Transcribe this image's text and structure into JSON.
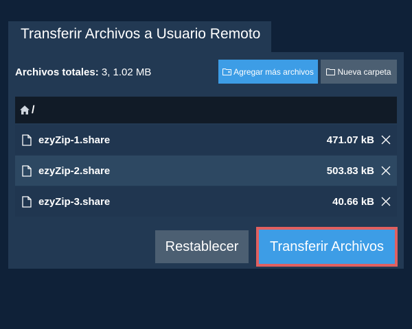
{
  "dialog": {
    "title": "Transferir Archivos a Usuario Remoto"
  },
  "summary": {
    "label": "Archivos totales:",
    "value": "3, 1.02 MB"
  },
  "toolbar": {
    "add_files_label": "Agregar más archivos",
    "new_folder_label": "Nueva carpeta"
  },
  "path": {
    "current": "/",
    "icon": "home-icon"
  },
  "files": [
    {
      "name": "ezyZip-1.share",
      "size": "471.07 kB",
      "icon": "file-icon"
    },
    {
      "name": "ezyZip-2.share",
      "size": "503.83 kB",
      "icon": "file-icon"
    },
    {
      "name": "ezyZip-3.share",
      "size": "40.66 kB",
      "icon": "file-icon"
    }
  ],
  "actions": {
    "reset_label": "Restablecer",
    "transfer_label": "Transferir Archivos"
  },
  "colors": {
    "background": "#0f2138",
    "panel": "#223953",
    "primary": "#3d9de6",
    "secondary": "#4c5f72",
    "highlight_border": "#e06060"
  }
}
